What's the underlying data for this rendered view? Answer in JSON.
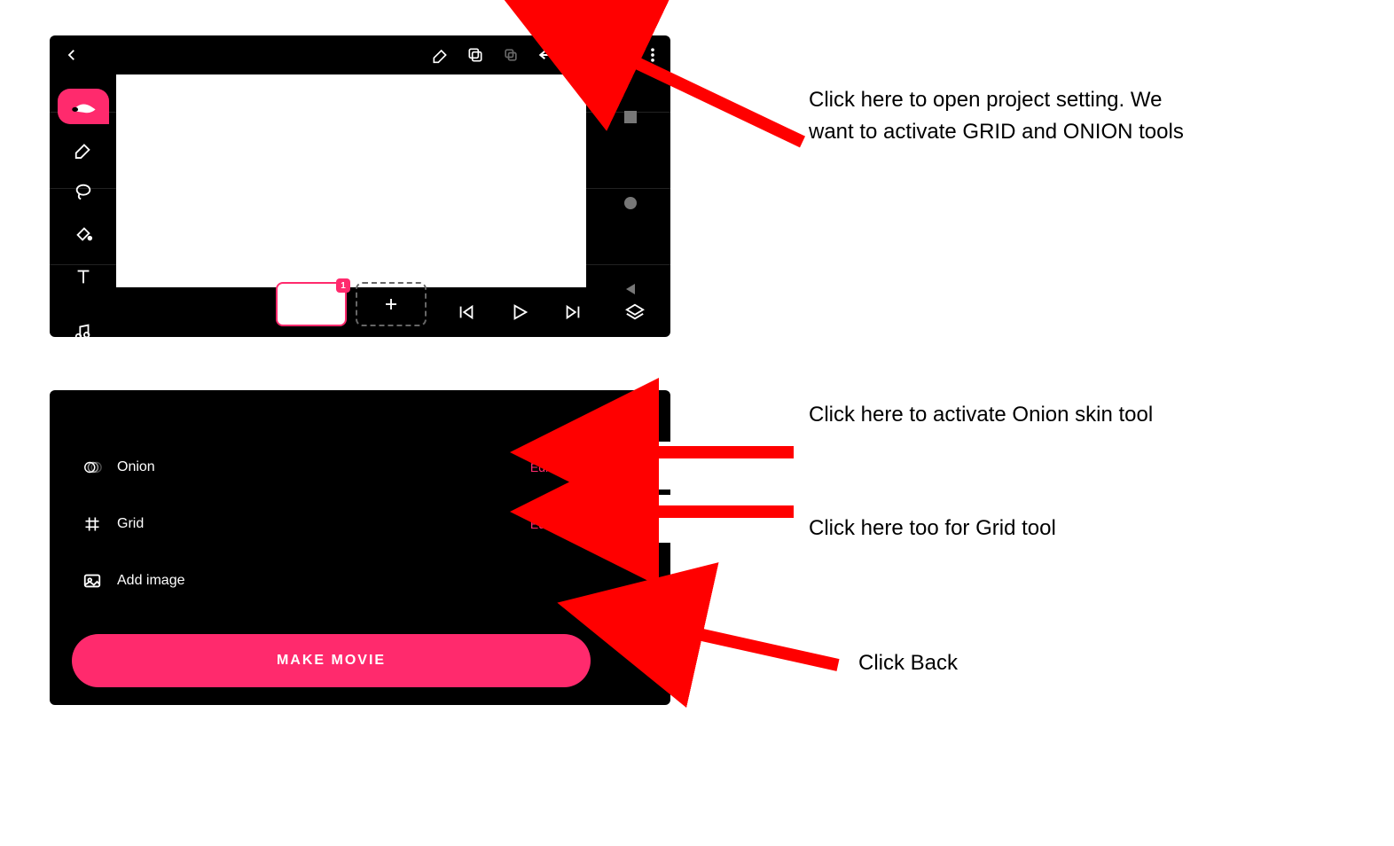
{
  "topShot": {
    "frameBadge": "1"
  },
  "settings": {
    "onion": {
      "label": "Onion",
      "edit": "Edit"
    },
    "grid": {
      "label": "Grid",
      "edit": "Edit"
    },
    "addImage": {
      "label": "Add image"
    },
    "makeMovie": "MAKE MOVIE"
  },
  "notes": {
    "openSettings": "Click here to open project setting. We want to activate GRID and ONION tools",
    "onion": "Click here to activate Onion skin tool",
    "grid": "Click here too for Grid tool",
    "back": "Click Back"
  },
  "colors": {
    "accent": "#ff2a6d",
    "arrow": "#ff0000"
  }
}
